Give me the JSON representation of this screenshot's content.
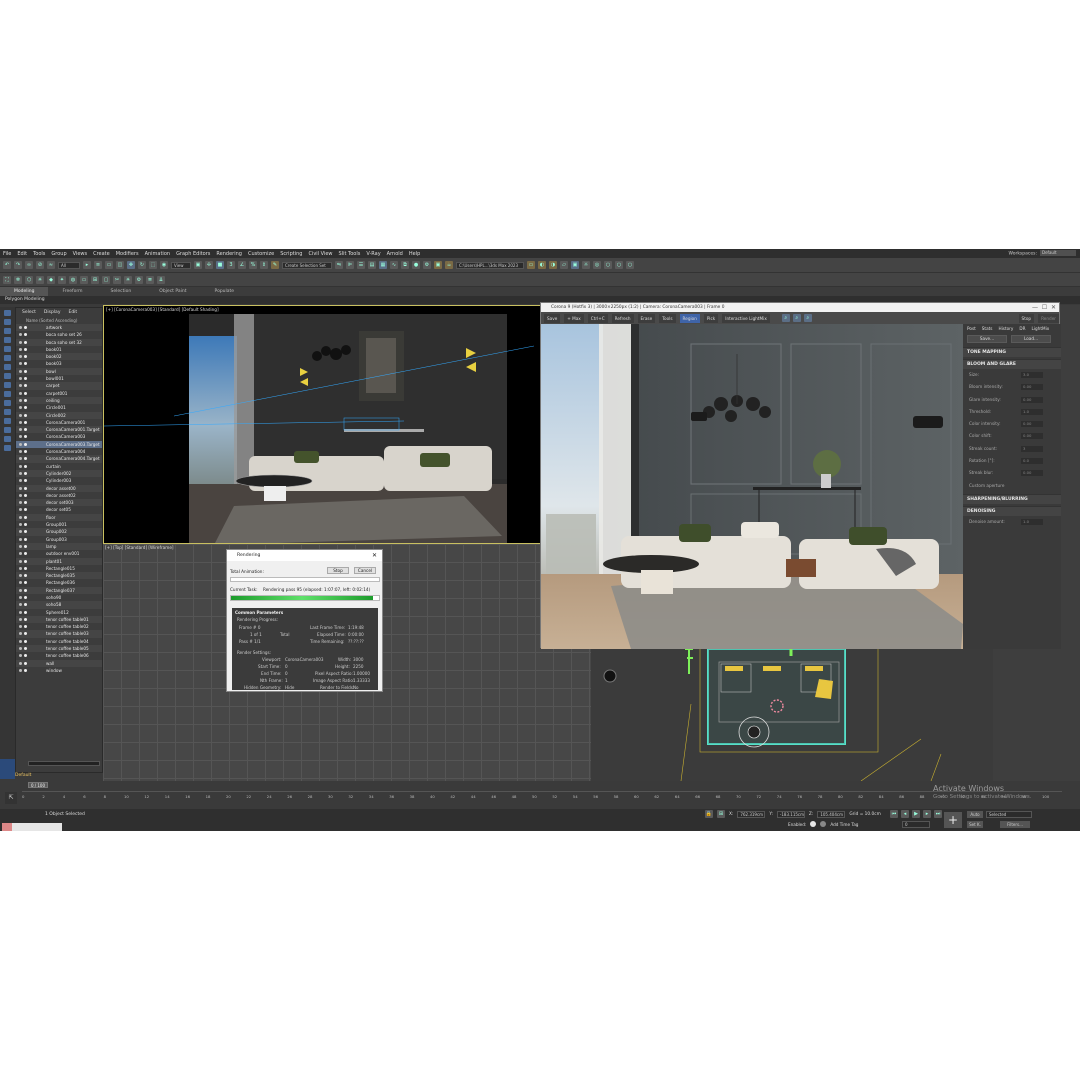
{
  "menu": [
    "File",
    "Edit",
    "Tools",
    "Group",
    "Views",
    "Create",
    "Modifiers",
    "Animation",
    "Graph Editors",
    "Rendering",
    "Customize",
    "Scripting",
    "Civil View",
    "Slit Tools",
    "V-Ray",
    "Arnold",
    "Help"
  ],
  "workspaces": {
    "label": "Workspaces:",
    "value": "Default"
  },
  "toolbar": {
    "filter_all": "All",
    "ref_coord": "View",
    "selection_set": "Create Selection Set",
    "project_path": "C:\\Users\\HPL...\\3ds Max 2023"
  },
  "ribbon": {
    "tabs": [
      "Modeling",
      "Freeform",
      "Selection",
      "Object Paint",
      "Populate"
    ],
    "mode": "Polygon Modeling"
  },
  "scene_explorer": {
    "tabs": [
      "Select",
      "Display",
      "Edit"
    ],
    "header": "Name (Sorted Ascending)",
    "items": [
      "artwork",
      "boca soho set 26",
      "boca soho set 32",
      "book01",
      "book02",
      "book03",
      "bowl",
      "bowl001",
      "carpet",
      "carpet001",
      "ceiling",
      "Circle001",
      "Circle002",
      "CoronaCamera001",
      "CoronaCamera001.Target",
      "CoronaCamera003",
      "CoronaCamera003.Target",
      "CoronaCamera004",
      "CoronaCamera004.Target",
      "curtain",
      "Cylinder002",
      "Cylinder003",
      "decor asset00",
      "decor asset02",
      "decor set003",
      "decor set05",
      "floor",
      "Group001",
      "Group002",
      "Group003",
      "lamp",
      "outdoor env001",
      "plant01",
      "Rectangle015",
      "Rectangle035",
      "Rectangle036",
      "Rectangle037",
      "soho90",
      "soho58",
      "Sphere012",
      "tenor coffee table01",
      "tenor coffee table02",
      "tenor coffee table03",
      "tenor coffee table04",
      "tenor coffee table05",
      "tenor coffee table06",
      "wall",
      "window"
    ],
    "selected_item": "CoronaCamera003.Target",
    "layer": "Default"
  },
  "viewports": {
    "camera_label": "[+] [CoronaCamera003] [Standard] [Default Shading]",
    "top_label": "[+] [Top] [Standard] [Wireframe]"
  },
  "vfb": {
    "title": "Corona 9 (Hotfix 3) | 3000×2250px (1:2) | Camera: CoronaCamera003 | Frame 0",
    "toolbar": [
      "Save",
      "+ Max",
      "Ctrl+C",
      "Refresh",
      "Erase",
      "Tools",
      "Region",
      "Pick",
      "Interactive LightMix"
    ],
    "stop": "Stop",
    "render": "Render",
    "panel_tabs": [
      "Post",
      "Stats",
      "History",
      "DR",
      "LightMix"
    ],
    "save_btn": "Save...",
    "load_btn": "Load...",
    "sections": {
      "tone": "TONE MAPPING",
      "bloom": "BLOOM AND GLARE",
      "sharpen": "SHARPENING/BLURRING",
      "denoise": "DENOISING"
    },
    "bloom_params": [
      {
        "label": "Size:",
        "value": "3.0"
      },
      {
        "label": "Bloom intensity:",
        "value": "0.00"
      },
      {
        "label": "Glare intensity:",
        "value": "0.00"
      },
      {
        "label": "Threshold:",
        "value": "1.0"
      },
      {
        "label": "Color intensity:",
        "value": "0.00"
      },
      {
        "label": "Color shift:",
        "value": "0.00"
      },
      {
        "label": "Streak count:",
        "value": "3"
      },
      {
        "label": "Rotation [°]:",
        "value": "0.0"
      },
      {
        "label": "Streak blur:",
        "value": "0.00"
      }
    ],
    "custom_aperture": "Custom aperture",
    "denoise_label": "Denoise amount:",
    "denoise_value": "1.0"
  },
  "rendering_dialog": {
    "title": "Rendering",
    "total_animation": "Total Animation:",
    "stop": "Stop",
    "cancel": "Cancel",
    "current_task_label": "Current Task:",
    "current_task": "Rendering pass 95 (elapsed: 1:07:07, left: 0:02:14)",
    "progress": 0.96,
    "common_params": "Common Parameters",
    "rendering_progress": "Rendering Progress:",
    "frame_label": "Frame #",
    "frame": "0",
    "of": "1 of 1",
    "total": "Total",
    "pass": "Pass #  1/1",
    "last_frame_time_label": "Last Frame Time:",
    "last_frame_time": "1:19:48",
    "elapsed_label": "Elapsed Time:",
    "elapsed": "0:00:00",
    "remaining_label": "Time Remaining:",
    "remaining": "??:??:??",
    "render_settings": "Render Settings:",
    "viewport_label": "Viewport:",
    "viewport": "CoronaCamera003",
    "width_label": "Width:",
    "width": "3000",
    "start_label": "Start Time:",
    "start": "0",
    "height_label": "Height:",
    "height": "2250",
    "end_label": "End Time:",
    "end": "0",
    "pixel_label": "Pixel Aspect Ratio:",
    "pixel": "1.00000",
    "nth_label": "Nth Frame:",
    "nth": "1",
    "image_label": "Image Aspect Ratio:",
    "image": "1.33333",
    "hidden_label": "Hidden Geometry:",
    "hidden": "Hide",
    "fields_label": "Render to Fields:",
    "fields": "No"
  },
  "timeline": {
    "frame_counter": "0 / 100",
    "ticks": [
      "0",
      "2",
      "4",
      "6",
      "8",
      "10",
      "12",
      "14",
      "16",
      "18",
      "20",
      "22",
      "24",
      "26",
      "28",
      "30",
      "32",
      "34",
      "36",
      "38",
      "40",
      "42",
      "44",
      "46",
      "48",
      "50",
      "52",
      "54",
      "56",
      "58",
      "60",
      "62",
      "64",
      "66",
      "68",
      "70",
      "72",
      "74",
      "76",
      "78",
      "80",
      "82",
      "84",
      "86",
      "88",
      "90",
      "92",
      "94",
      "96",
      "98",
      "100"
    ]
  },
  "status": {
    "objects": "1 Object Selected",
    "x_label": "X:",
    "x": "762.319cm",
    "y_label": "Y:",
    "y": "-183.115cm",
    "z_label": "Z:",
    "z": "105.404cm",
    "grid": "Grid = 10.0cm",
    "enabled": "Enabled:",
    "add_time_tag": "Add Time Tag",
    "auto": "Auto",
    "set_k": "Set K.",
    "selected": "Selected",
    "filters": "Filters...",
    "spinner": "0"
  },
  "activate_windows": {
    "title": "Activate Windows",
    "sub": "Go to Settings to activate Windows."
  }
}
